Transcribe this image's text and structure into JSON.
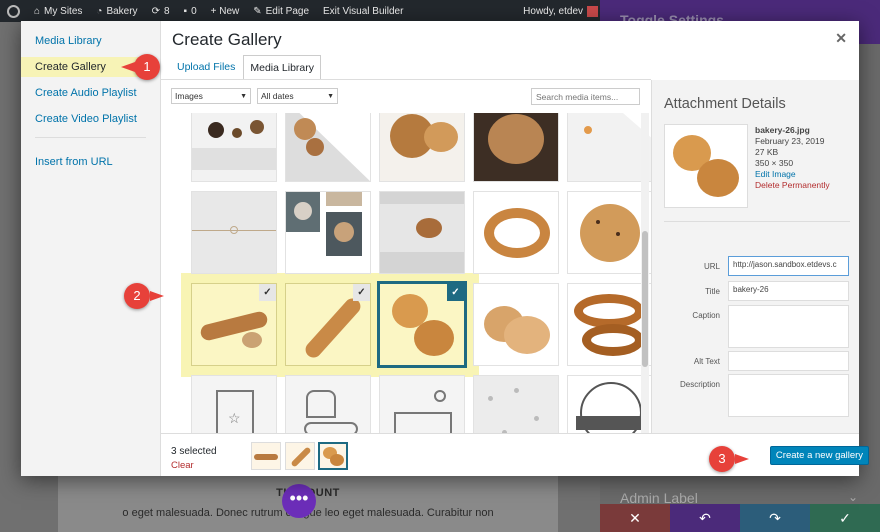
{
  "admin_bar": {
    "my_sites": "My Sites",
    "site_name": "Bakery",
    "updates_count": "8",
    "comments_count": "0",
    "new_label": "+ New",
    "edit_page": "Edit Page",
    "exit_builder": "Exit Visual Builder",
    "greeting": "Howdy, etdev"
  },
  "modal": {
    "title": "Create Gallery",
    "menu": [
      {
        "label": "Media Library"
      },
      {
        "label": "Create Gallery"
      },
      {
        "label": "Create Audio Playlist"
      },
      {
        "label": "Create Video Playlist"
      },
      {
        "label": "Insert from URL"
      }
    ],
    "tabs": [
      {
        "label": "Upload Files"
      },
      {
        "label": "Media Library"
      }
    ],
    "filters": {
      "type": "Images",
      "dates": "All dates",
      "search_placeholder": "Search media items..."
    },
    "selection": {
      "count_text": "3 selected",
      "clear": "Clear"
    },
    "create_button": "Create a new gallery"
  },
  "details": {
    "title": "Attachment Details",
    "filename": "bakery-26.jpg",
    "date": "February 23, 2019",
    "size": "27 KB",
    "dimensions": "350 × 350",
    "edit_image": "Edit Image",
    "delete": "Delete Permanently",
    "fields": [
      {
        "label": "URL",
        "value": "http://jason.sandbox.etdevs.c"
      },
      {
        "label": "Title",
        "value": "bakery-26"
      },
      {
        "label": "Caption",
        "value": ""
      },
      {
        "label": "Alt Text",
        "value": ""
      },
      {
        "label": "Description",
        "value": ""
      }
    ]
  },
  "background": {
    "heading": "TINCIDUNT",
    "paragraph": "o eget malesuada. Donec rutrum congue leo eget malesuada. Curabitur non",
    "panel_title": "Toggle Settings",
    "admin_label": "Admin Label"
  },
  "callouts": [
    "1",
    "2",
    "3"
  ],
  "colors": {
    "accent": "#0085ba",
    "highlight": "#f8f4b4",
    "selected_border": "#1e6a82",
    "callout": "#e7413a"
  }
}
